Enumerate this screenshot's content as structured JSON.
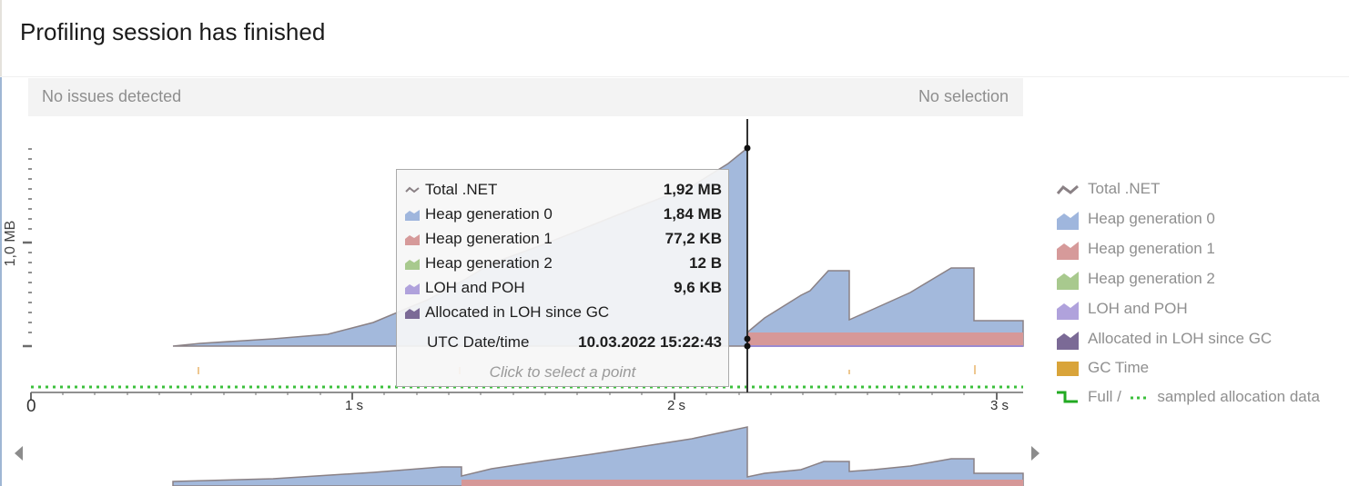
{
  "header": {
    "title": "Profiling session has finished"
  },
  "status_bar": {
    "issues": "No issues detected",
    "selection": "No selection"
  },
  "chart": {
    "y_axis_label": "1,0 MB",
    "x_tick_labels": [
      "0",
      "1 s",
      "2 s",
      "3 s"
    ]
  },
  "tooltip": {
    "rows": [
      {
        "label": "Total .NET",
        "value": "1,92 MB"
      },
      {
        "label": "Heap generation 0",
        "value": "1,84 MB"
      },
      {
        "label": "Heap generation 1",
        "value": "77,2 KB"
      },
      {
        "label": "Heap generation 2",
        "value": "12 B"
      },
      {
        "label": "LOH and POH",
        "value": "9,6 KB"
      },
      {
        "label": "Allocated in LOH since GC",
        "value": ""
      }
    ],
    "date_label": "UTC Date/time",
    "date_value": "10.03.2022 15:22:43",
    "hint": "Click to select a point"
  },
  "legend": {
    "items": [
      {
        "label": "Total .NET",
        "icon": "total-line-icon",
        "color": "#8a8185"
      },
      {
        "label": "Heap generation 0",
        "icon": "area-icon",
        "color": "#9fb6dd"
      },
      {
        "label": "Heap generation 1",
        "icon": "area-icon",
        "color": "#d69a9a"
      },
      {
        "label": "Heap generation 2",
        "icon": "area-icon",
        "color": "#a8c98e"
      },
      {
        "label": "LOH and POH",
        "icon": "area-icon",
        "color": "#b0a2dc"
      },
      {
        "label": "Allocated in LOH since GC",
        "icon": "area-icon",
        "color": "#7b6a96"
      },
      {
        "label": "GC Time",
        "icon": "square-icon",
        "color": "#d9a43a"
      },
      {
        "label": "Full /",
        "label2": "sampled allocation data",
        "icon": "step-line-icon",
        "color": "#22aa22"
      }
    ]
  },
  "colors": {
    "gen0": "#a3b9dc",
    "gen1": "#d69898",
    "total_line": "#8a8185",
    "cursor": "#333333",
    "sampled": "#3cc03c"
  }
}
